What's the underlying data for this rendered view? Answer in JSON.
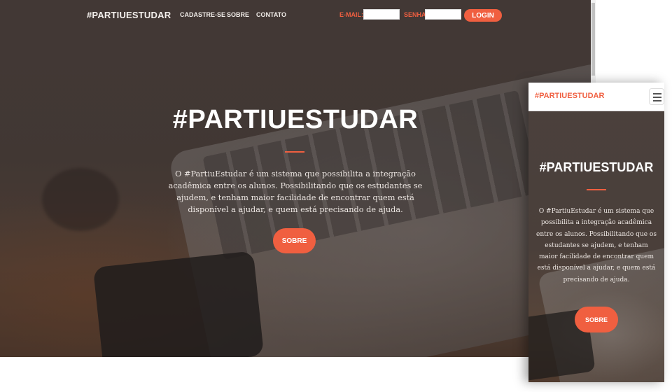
{
  "desktop": {
    "brand": "#PARTIUESTUDAR",
    "nav_links": [
      "CADASTRE-SE",
      "SOBRE",
      "CONTATO"
    ],
    "email_label": "E-MAIL:",
    "email_value": "",
    "password_label": "SENHA:",
    "password_value": "",
    "login_label": "LOGIN",
    "hero_title": "#PARTIUESTUDAR",
    "hero_text": "O #PartiuEstudar é um sistema que possibilita a integração acadêmica entre os alunos. Possibilitando que os estudantes se ajudem, e tenham maior facilidade de encontrar quem está disponível a ajudar, e quem está precisando de ajuda.",
    "hero_button": "SOBRE"
  },
  "mobile": {
    "brand": "#PARTIUESTUDAR",
    "hero_title": "#PARTIUESTUDAR",
    "hero_text": "O #PartiuEstudar é um sistema que possibilita a integração acadêmica entre os alunos. Possibilitando que os estudantes se ajudem, e tenham maior facilidade de encontrar quem está disponível a ajudar, e quem está precisando de ajuda.",
    "hero_button": "SOBRE"
  },
  "colors": {
    "accent": "#f05f40",
    "overlay": "#4a3f3a",
    "text_light": "#ffffff"
  },
  "icons": {
    "menu_toggle": "hamburger-icon"
  }
}
